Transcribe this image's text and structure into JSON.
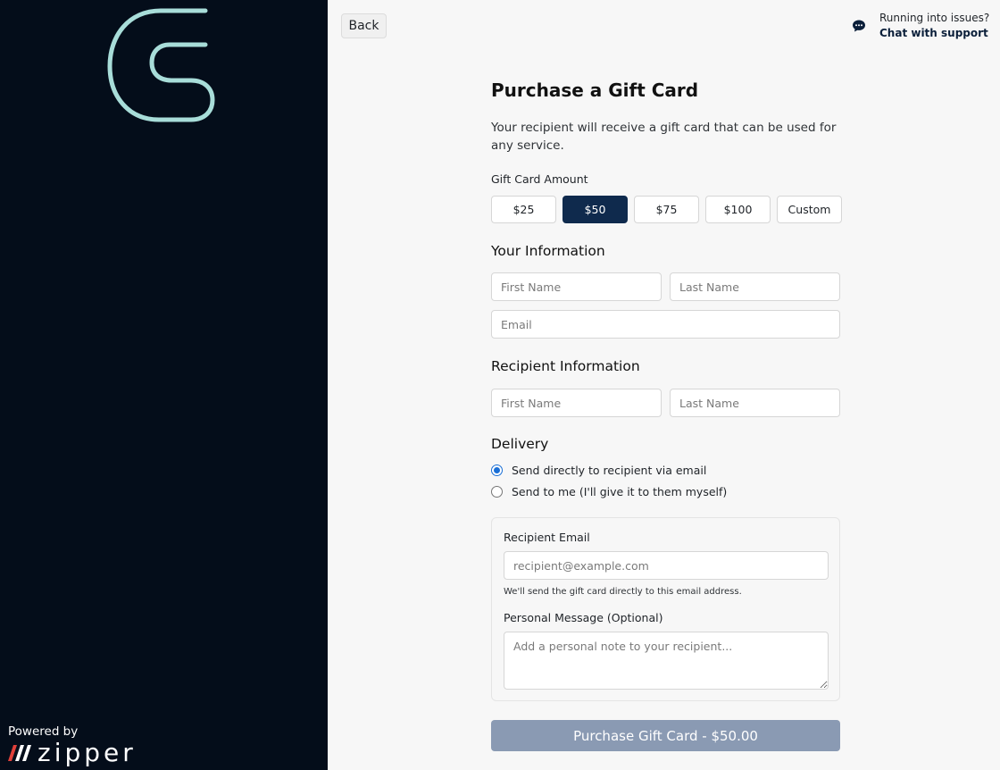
{
  "sidebar": {
    "powered_by": "Powered by",
    "platform_name": "zipper",
    "logo_icon": "brand-g-logo"
  },
  "header": {
    "back_label": "Back",
    "support_question": "Running into issues?",
    "support_link": "Chat with support",
    "support_icon": "chat-bubble-icon"
  },
  "form": {
    "title": "Purchase a Gift Card",
    "subtitle": "Your recipient will receive a gift card that can be used for any service.",
    "amount_label": "Gift Card Amount",
    "amounts": [
      "$25",
      "$50",
      "$75",
      "$100",
      "Custom"
    ],
    "selected_amount": "$50",
    "your_info": {
      "heading": "Your Information",
      "first_name_placeholder": "First Name",
      "last_name_placeholder": "Last Name",
      "email_placeholder": "Email"
    },
    "recipient_info": {
      "heading": "Recipient Information",
      "first_name_placeholder": "First Name",
      "last_name_placeholder": "Last Name"
    },
    "delivery": {
      "heading": "Delivery",
      "options": [
        "Send directly to recipient via email",
        "Send to me (I'll give it to them myself)"
      ],
      "selected_index": 0
    },
    "email_panel": {
      "recipient_email_label": "Recipient Email",
      "recipient_email_placeholder": "recipient@example.com",
      "hint": "We'll send the gift card directly to this email address.",
      "message_label": "Personal Message (Optional)",
      "message_placeholder": "Add a personal note to your recipient..."
    },
    "submit_label": "Purchase Gift Card - $50.00"
  },
  "colors": {
    "sidebar_bg": "#040d1a",
    "brand_accent": "#a8ddd9",
    "selected_amount_bg": "#0f2a4d",
    "submit_bg": "#8a9ab3",
    "zipper_red": "#e0403a"
  }
}
